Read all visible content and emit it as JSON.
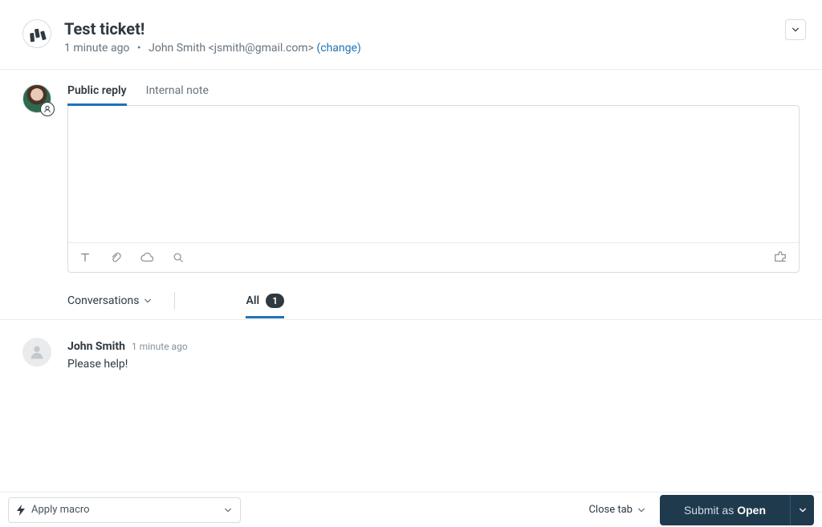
{
  "header": {
    "title": "Test ticket!",
    "time_ago": "1 minute ago",
    "requester": "John Smith <jsmith@gmail.com>",
    "change_label": "(change)"
  },
  "reply": {
    "tab_public": "Public reply",
    "tab_internal": "Internal note"
  },
  "filter": {
    "conversations_label": "Conversations",
    "all_label": "All",
    "all_count": "1"
  },
  "messages": [
    {
      "author": "John Smith",
      "time": "1 minute ago",
      "body": "Please help!"
    }
  ],
  "footer": {
    "macro_label": "Apply macro",
    "close_tab_label": "Close tab",
    "submit_prefix": "Submit as",
    "submit_status": "Open"
  }
}
